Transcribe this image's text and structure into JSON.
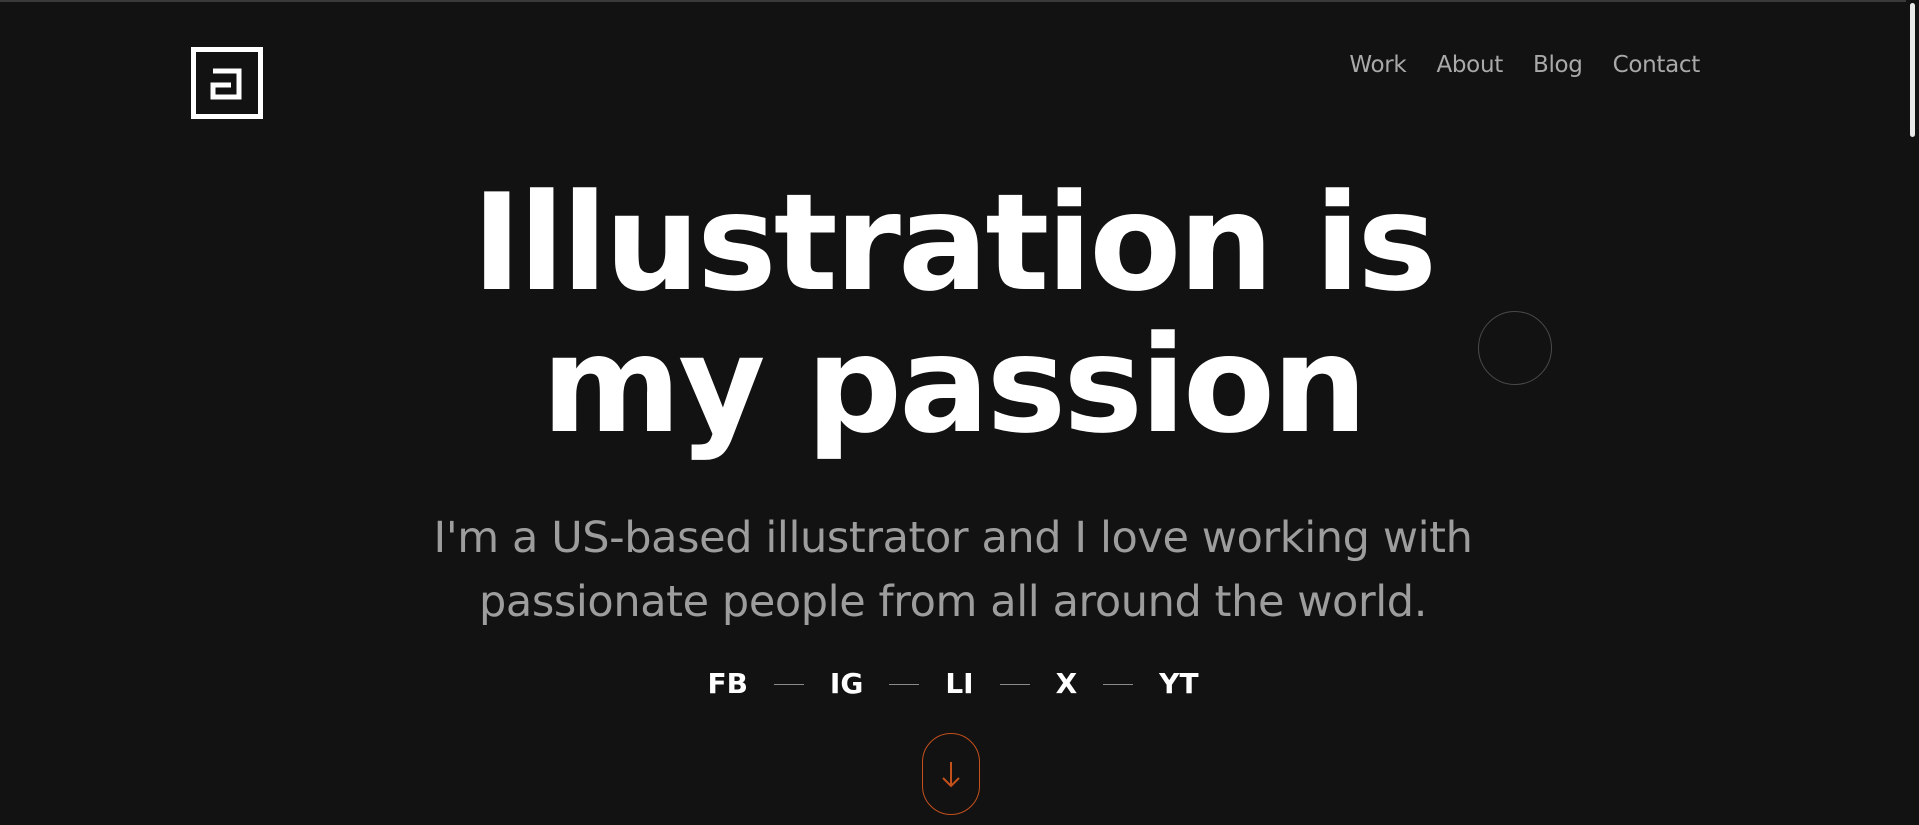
{
  "header": {
    "logo_icon": "square-a-logo-icon",
    "nav": [
      {
        "label": "Work"
      },
      {
        "label": "About"
      },
      {
        "label": "Blog"
      },
      {
        "label": "Contact"
      }
    ]
  },
  "hero": {
    "title_line1": "Illustration is",
    "title_line2": "my passion",
    "subtitle_line1": "I'm a US-based illustrator and I love working with",
    "subtitle_line2": "passionate people from all around the world."
  },
  "social": [
    {
      "label": "FB"
    },
    {
      "label": "IG"
    },
    {
      "label": "LI"
    },
    {
      "label": "X"
    },
    {
      "label": "YT"
    }
  ],
  "scroll_button": {
    "icon": "arrow-down-icon"
  },
  "colors": {
    "background": "#121212",
    "text": "#ffffff",
    "muted_text": "#9d9d9d",
    "accent": "#c4501c"
  }
}
